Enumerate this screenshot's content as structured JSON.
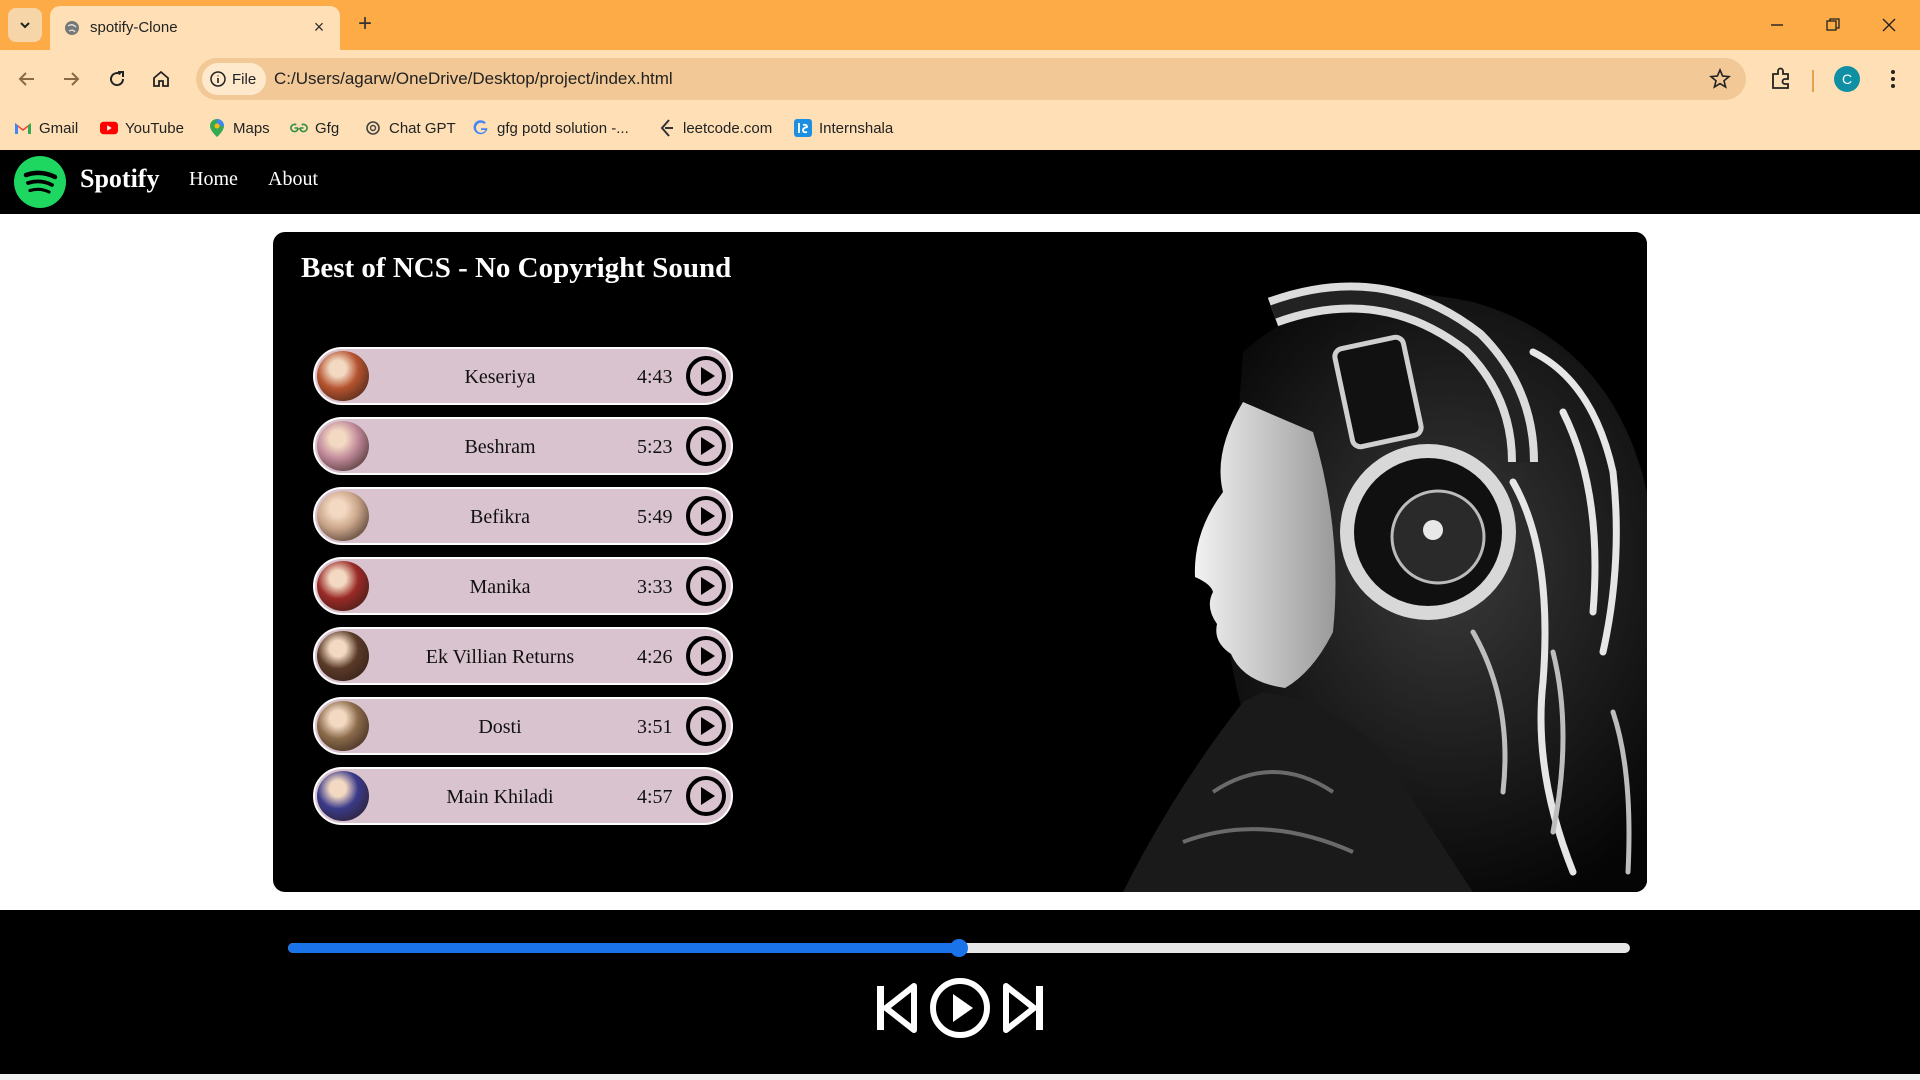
{
  "browser": {
    "tab_title": "spotify-Clone",
    "address_chip": "File",
    "url": "C:/Users/agarw/OneDrive/Desktop/project/index.html",
    "profile_initial": "C",
    "bookmarks": [
      {
        "label": "Gmail",
        "icon": "gmail-icon"
      },
      {
        "label": "YouTube",
        "icon": "youtube-icon"
      },
      {
        "label": "Maps",
        "icon": "maps-icon"
      },
      {
        "label": "Gfg",
        "icon": "gfg-icon"
      },
      {
        "label": "Chat GPT",
        "icon": "chatgpt-icon"
      },
      {
        "label": "gfg potd solution -...",
        "icon": "google-icon"
      },
      {
        "label": "leetcode.com",
        "icon": "leetcode-icon"
      },
      {
        "label": "Internshala",
        "icon": "internshala-icon"
      }
    ]
  },
  "navbar": {
    "brand": "Spotify",
    "links": [
      "Home",
      "About"
    ]
  },
  "main": {
    "title": "Best of NCS - No Copyright Sound",
    "songs": [
      {
        "name": "Keseriya",
        "duration": "4:43",
        "thumb_color": "#b5532f"
      },
      {
        "name": "Beshram",
        "duration": "5:23",
        "thumb_color": "#c08a9a"
      },
      {
        "name": "Befikra",
        "duration": "5:49",
        "thumb_color": "#caa58a"
      },
      {
        "name": "Manika",
        "duration": "3:33",
        "thumb_color": "#9a2a26"
      },
      {
        "name": "Ek Villian Returns",
        "duration": "4:26",
        "thumb_color": "#5a3a28"
      },
      {
        "name": "Dosti",
        "duration": "3:51",
        "thumb_color": "#8a6a4a"
      },
      {
        "name": "Main Khiladi",
        "duration": "4:57",
        "thumb_color": "#3a3a8a"
      }
    ]
  },
  "player": {
    "progress": 0.5,
    "accent": "#1a73e8",
    "controls": [
      "previous-icon",
      "play-icon",
      "next-icon"
    ]
  }
}
